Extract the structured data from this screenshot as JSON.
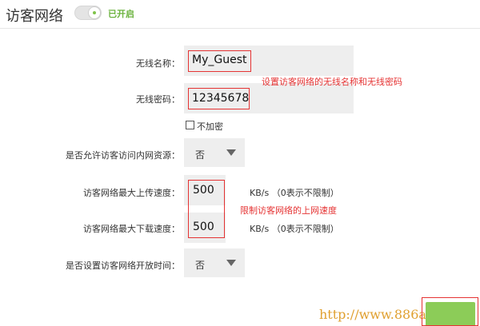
{
  "header": {
    "title": "访客网络",
    "toggle_status": "已开启"
  },
  "form": {
    "ssid": {
      "label": "无线名称：",
      "value": "My_Guest"
    },
    "password": {
      "label": "无线密码：",
      "value": "12345678"
    },
    "no_encrypt": {
      "label": "不加密",
      "checked": false
    },
    "allow_intranet": {
      "label": "是否允许访客访问内网资源：",
      "value": "否"
    },
    "upload": {
      "label": "访客网络最大上传速度：",
      "value": "500",
      "unit": "KB/s （0表示不限制）"
    },
    "download": {
      "label": "访客网络最大下载速度：",
      "value": "500",
      "unit": "KB/s （0表示不限制）"
    },
    "schedule": {
      "label": "是否设置访客网络开放时间：",
      "value": "否"
    }
  },
  "annotations": {
    "ssid_pwd": "设置访客网络的无线名称和无线密码",
    "speed": "限制访客网络的上网速度"
  },
  "watermark": "http://www.886abc.com",
  "colors": {
    "accent_green": "#8ccc58",
    "status_green": "#6cb33f",
    "annotation_red": "#e53333",
    "field_bg": "#eeeeee"
  }
}
